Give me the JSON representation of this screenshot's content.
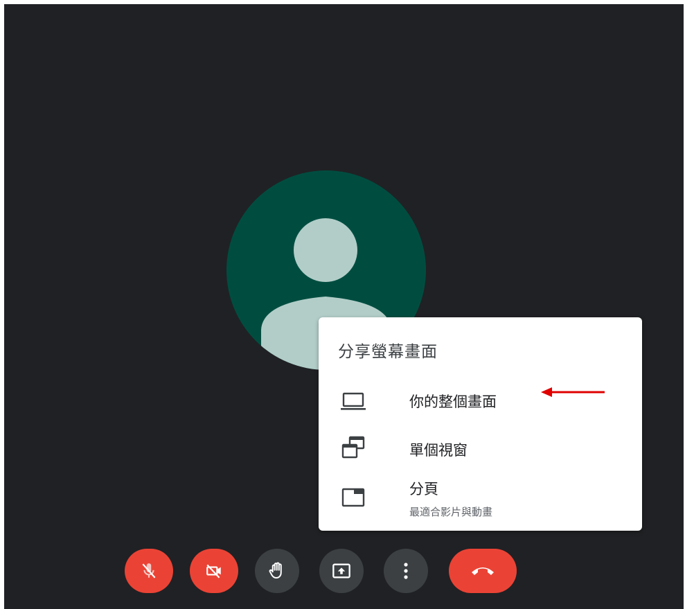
{
  "share_menu": {
    "title": "分享螢幕畫面",
    "items": [
      {
        "label": "你的整個畫面",
        "icon": "laptop-icon"
      },
      {
        "label": "單個視窗",
        "icon": "window-stack-icon"
      },
      {
        "label": "分頁",
        "subtitle": "最適合影片與動畫",
        "icon": "tab-icon"
      }
    ]
  },
  "controls": [
    {
      "name": "microphone-toggle",
      "icon": "mic-off-icon",
      "state": "off",
      "color": "#ea4335"
    },
    {
      "name": "camera-toggle",
      "icon": "videocam-off-icon",
      "state": "off",
      "color": "#ea4335"
    },
    {
      "name": "raise-hand",
      "icon": "hand-icon",
      "color": "#3c4043"
    },
    {
      "name": "present-now",
      "icon": "present-to-all-icon",
      "color": "#3c4043"
    },
    {
      "name": "more-options",
      "icon": "more-vert-icon",
      "color": "#3c4043"
    },
    {
      "name": "leave-call",
      "icon": "call-end-icon",
      "color": "#ea4335"
    }
  ],
  "annotation": {
    "arrow_color": "#e00000"
  },
  "colors": {
    "background": "#202124",
    "avatar_bg": "#004d40",
    "avatar_fg": "#b2cdc8",
    "danger": "#ea4335",
    "control_grey": "#3c4043"
  }
}
